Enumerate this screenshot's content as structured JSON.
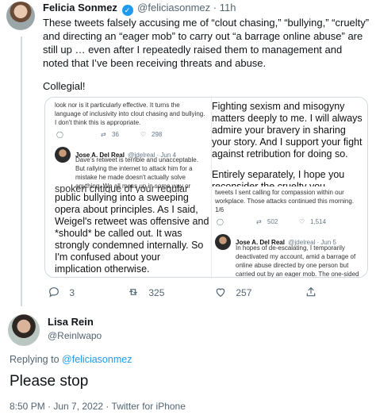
{
  "tweet1": {
    "name": "Felicia Sonmez",
    "handle": "@feliciasonmez",
    "sep": "·",
    "time": "11h",
    "text": "These tweets falsely accusing me of “clout chasing,” “bullying,” “cruelty” and directing an “eager mob” to carry out “a barrage online abuse” are still up … even after I repeatedly raised them to management and noted that I’ve been receiving threats and abuse.",
    "text2": "Collegial!",
    "stats": {
      "replies": "3",
      "retweets": "325",
      "likes": "257"
    }
  },
  "screenshot": {
    "left": {
      "top_text": "look nor is it particularly effective. It turns the language of inclusivity into clout chasing and bullying. I don't think this is appropriate.",
      "top_stats": {
        "replies": "",
        "retweets": "36",
        "likes": "298"
      },
      "author": "Jose A. Del Real",
      "author_handle": "@jdelreal · Jun 4",
      "author_text": "Dave's retweet is terrible and unacceptable. But rallying the internet to attack him for a mistake he made doesn't actually solve anything. We all mess up in some way or",
      "overlap_text": "spoken critique of your regular",
      "body": "public bullying into a sweeping opera about principles. As I said, Weigel's retweet was offensive and *should* be called out. It was strongly condemned internally. So I'm confused about your implication otherwise."
    },
    "right": {
      "top": "Fighting sexism and misogyny matters deeply to me. I will always admire your bravery in sharing your story.  And I support your fight against retribution for doing so.",
      "second": "Entirely separately, I hope you reconsider the cruelty you",
      "overlap_text": "tweets I sent calling for compassion within our workplace. Those attacks continued this morning. 1/6",
      "stats": {
        "replies": "",
        "retweets": "502",
        "likes": "1,514"
      },
      "author": "Jose A. Del Real",
      "author_handle": "@jdelreal · Jun 5",
      "author_text": "In hopes of de-escalating, I temporarily deactivated my account, amid a barrage of online abuse directed by one person but carried out by an eager mob. The one-sided"
    }
  },
  "tweet2": {
    "name": "Lisa Rein",
    "handle": "@Reinlwapo",
    "reply_prefix": "Replying to",
    "reply_to": "@feliciasonmez",
    "text": "Please stop",
    "meta": "8:50 PM · Jun 7, 2022 · Twitter for iPhone"
  },
  "colors": {
    "accent": "#1d9bf0",
    "muted": "#536471"
  }
}
